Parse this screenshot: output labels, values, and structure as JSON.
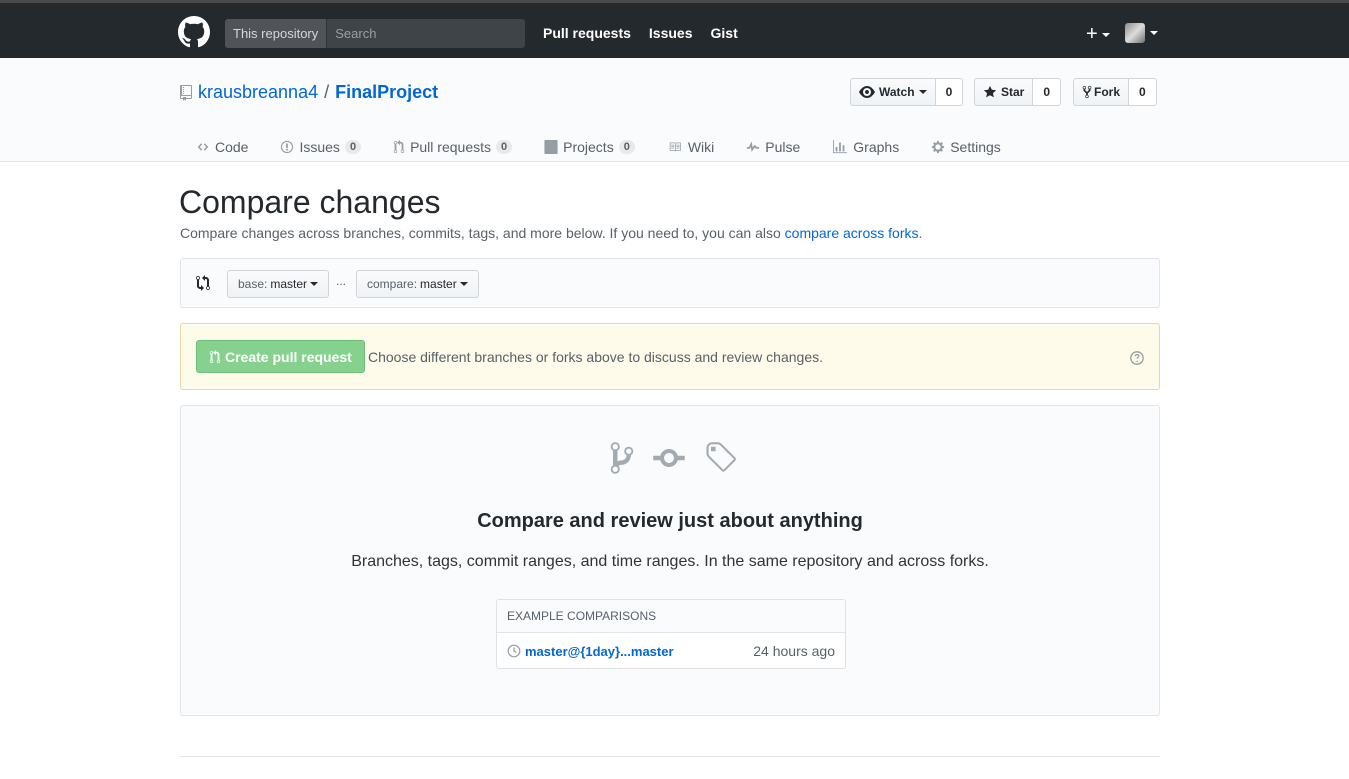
{
  "header": {
    "scope": "This repository",
    "search_placeholder": "Search",
    "nav": [
      "Pull requests",
      "Issues",
      "Gist"
    ],
    "plus": "+"
  },
  "repo": {
    "owner": "krausbreanna4",
    "separator": "/",
    "name": "FinalProject",
    "watch": {
      "label": "Watch",
      "count": "0"
    },
    "star": {
      "label": "Star",
      "count": "0"
    },
    "fork": {
      "label": "Fork",
      "count": "0"
    },
    "tabs": [
      {
        "label": "Code",
        "icon": "code-icon"
      },
      {
        "label": "Issues",
        "counter": "0",
        "icon": "issue-icon"
      },
      {
        "label": "Pull requests",
        "counter": "0",
        "icon": "pull-request-icon"
      },
      {
        "label": "Projects",
        "counter": "0",
        "icon": "project-icon"
      },
      {
        "label": "Wiki",
        "icon": "book-icon"
      },
      {
        "label": "Pulse",
        "icon": "pulse-icon"
      },
      {
        "label": "Graphs",
        "icon": "graph-icon"
      },
      {
        "label": "Settings",
        "icon": "gear-icon"
      }
    ]
  },
  "main": {
    "title": "Compare changes",
    "desc_prefix": "Compare changes across branches, commits, tags, and more below. If you need to, you can also ",
    "desc_link": "compare across forks",
    "desc_suffix": ".",
    "base_label": "base:",
    "base_value": "master",
    "ellipsis": "...",
    "compare_label": "compare:",
    "compare_value": "master",
    "create_button": "Create pull request",
    "flash_text": "Choose different branches or forks above to discuss and review changes.",
    "blank_title": "Compare and review just about anything",
    "blank_desc": "Branches, tags, commit ranges, and time ranges. In the same repository and across forks.",
    "examples_header": "EXAMPLE COMPARISONS",
    "example_link": "master@{1day}...master",
    "example_time": "24 hours ago"
  },
  "colors": {
    "header_bg": "#24292e",
    "link": "#0366d6",
    "create_button_bg": "#87d18f",
    "flash_bg": "#fffbea"
  }
}
